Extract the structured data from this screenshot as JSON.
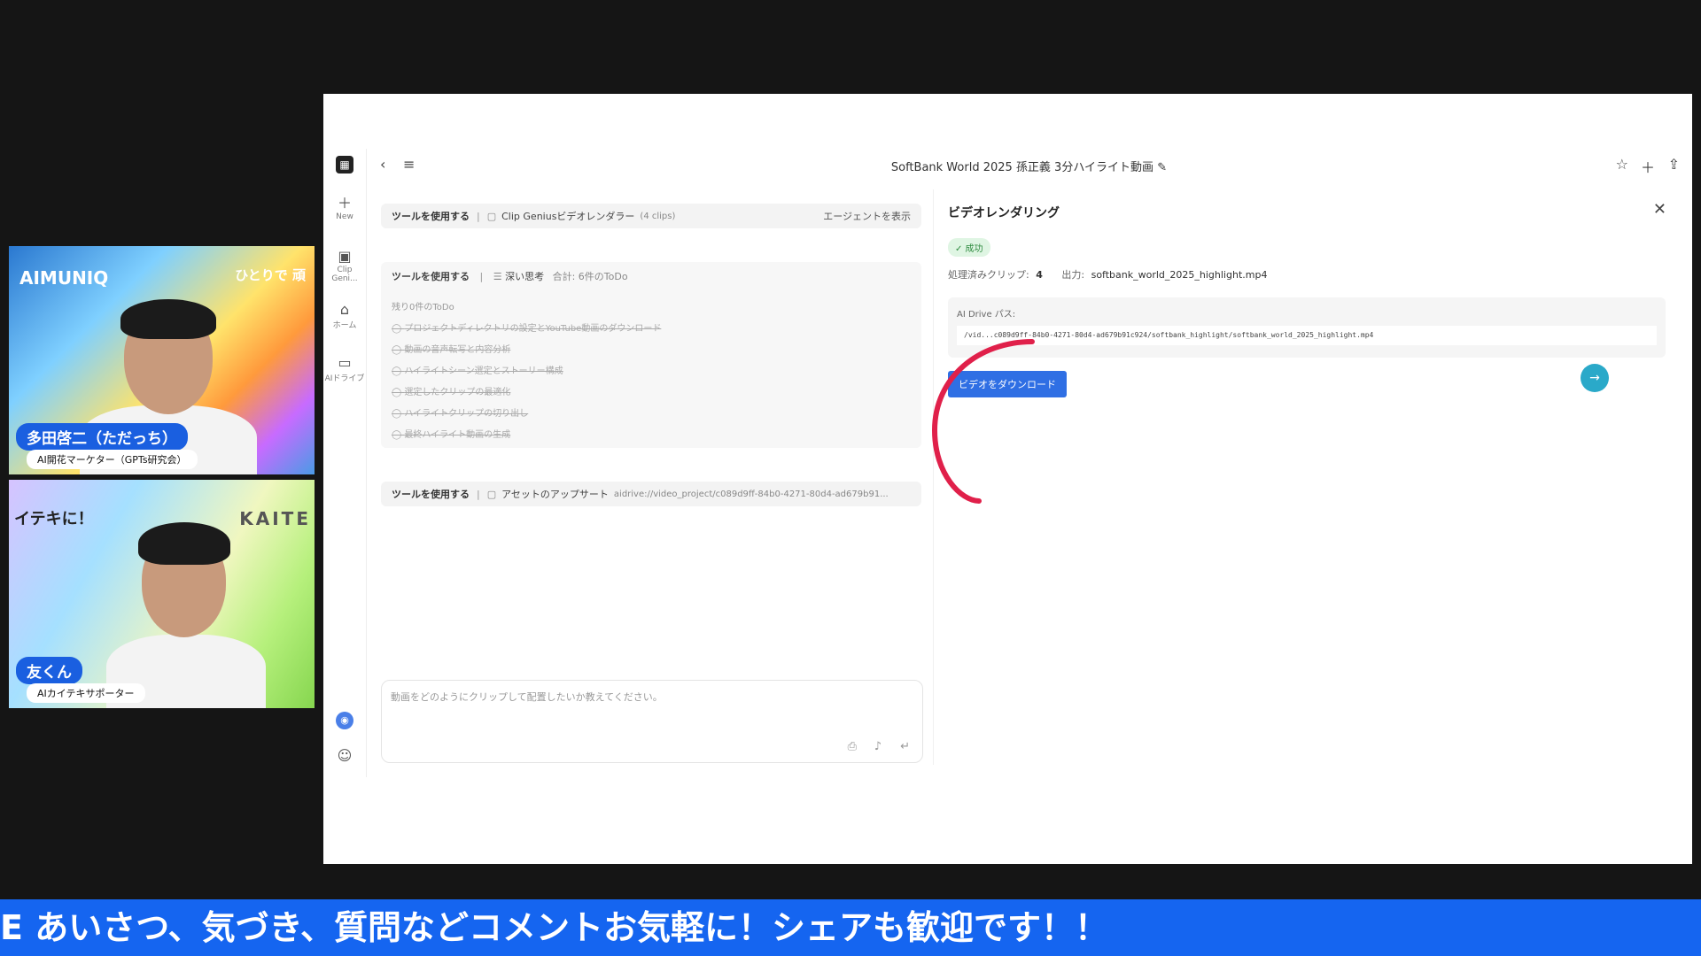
{
  "speakers": [
    {
      "name": "多田啓二（ただっち）",
      "role": "AI開花マーケター（GPTs研究会）",
      "logo": "AIMUNIQ",
      "banner": "ひとりで 頑"
    },
    {
      "name": "友くん",
      "role": "AIカイテキサポーター",
      "logo": "KAITE",
      "banner": "イテキに！"
    }
  ],
  "app": {
    "title": "SoftBank World 2025 孫正義 3分ハイライト動画",
    "rail": [
      {
        "icon": "＋",
        "label": "New"
      },
      {
        "icon": "▣",
        "label": "Clip Geni..."
      },
      {
        "icon": "⌂",
        "label": "ホーム"
      },
      {
        "icon": "▭",
        "label": "AIドライブ"
      }
    ],
    "tool_rows": [
      {
        "prefix": "ツールを使用する",
        "name": "Clip Geniusビデオレンダラー",
        "extra": "(4 clips)",
        "action": "エージェントを表示"
      },
      {
        "prefix": "ツールを使用する",
        "name": "深い思考",
        "extra": "合計: 6件のToDo"
      },
      {
        "prefix": "ツールを使用する",
        "name": "アセットのアップサート",
        "extra": "aidrive://video_project/c089d9ff-84b0-4271-80d4-ad679b91..."
      }
    ],
    "todo": {
      "remaining": "残り0件のToDo",
      "items": [
        "プロジェクトディレクトリの設定とYouTube動画のダウンロード",
        "動画の音声転写と内容分析",
        "ハイライトシーン選定とストーリー構成",
        "選定したクリップの最適化",
        "ハイライトクリップの切り出し",
        "最終ハイライト動画の生成"
      ]
    },
    "chat_placeholder": "動画をどのようにクリップして配置したいか教えてください。",
    "panel": {
      "title": "ビデオレンダリング",
      "status": "✓ 成功",
      "clips_label": "処理済みクリップ:",
      "clips_value": "4",
      "output_label": "出力:",
      "output_value": "softbank_world_2025_highlight.mp4",
      "path_label": "AI Drive パス:",
      "path_value": "/vid...c089d9ff-84b0-4271-80d4-ad679b91c924/softbank_highlight/softbank_world_2025_highlight.mp4",
      "download_label": "ビデオをダウンロード"
    }
  },
  "ticker": "E あいさつ、気づき、質問などコメントお気軽に！シェアも歓迎です！！",
  "colors": {
    "ticker": "#1565f0",
    "button": "#2f6fe4",
    "annotation": "#e0204a"
  }
}
